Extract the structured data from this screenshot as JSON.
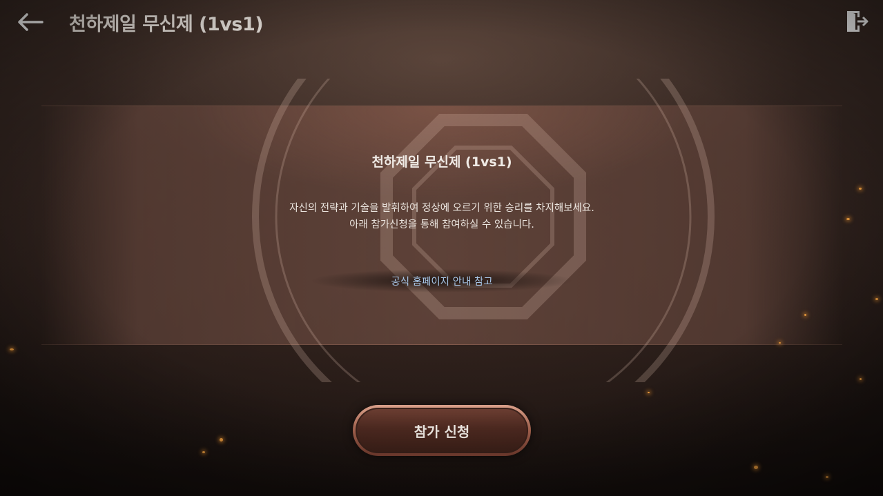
{
  "header": {
    "title": "천하제일 무신제 (1vs1)"
  },
  "panel": {
    "title": "천하제일 무신제 (1vs1)",
    "description_line1": "자신의 전략과 기술을 발휘하여 정상에 오르기 위한 승리를 차지해보세요.",
    "description_line2": "아래 참가신청을 통해 참여하실 수 있습니다.",
    "homepage_link": "공식 홈페이지 안내 참고"
  },
  "apply_button": {
    "label": "참가 신청"
  },
  "colors": {
    "link": "#a9c8ea",
    "button_rim": "#c88a72",
    "button_fill": "#4f2a21"
  }
}
